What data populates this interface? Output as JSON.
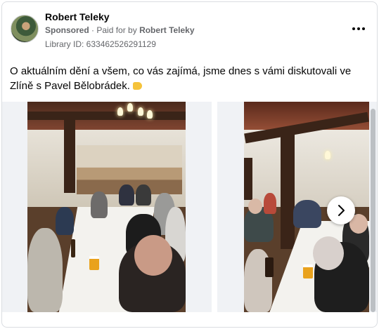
{
  "post": {
    "author": "Robert Teleky",
    "sponsored_label": "Sponsored",
    "paid_for_prefix": "· Paid for by",
    "paid_for_name": "Robert Teleky",
    "library_id": "Library ID: 633462526291129",
    "text": "O aktuálním dění a všem, co vás zajímá, jsme dnes s vámi diskutovali ve Zlíně s Pavel Bělobrádek.",
    "emoji": "yellow-heart-emoji"
  },
  "icons": {
    "more": "more-options-icon",
    "next": "chevron-right-icon",
    "avatar": "profile-picture"
  },
  "colors": {
    "text_primary": "#050505",
    "text_secondary": "#65676b",
    "border": "#dadde1",
    "carousel_bg": "#f0f2f5",
    "scrollbar": "#bcc0c4"
  },
  "carousel": {
    "slides": [
      {
        "image": "photo-meeting-hall-wide"
      },
      {
        "image": "photo-meeting-hall-side"
      }
    ]
  }
}
